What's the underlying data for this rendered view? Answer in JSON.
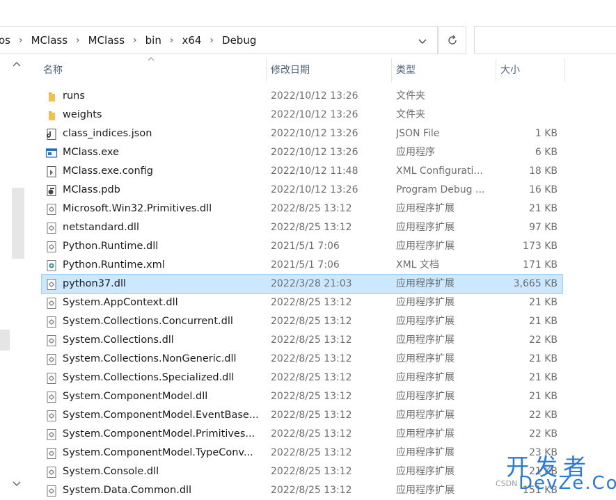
{
  "breadcrumb": {
    "items": [
      "os",
      "MClass",
      "MClass",
      "bin",
      "x64",
      "Debug"
    ]
  },
  "columns": {
    "name": "名称",
    "date": "修改日期",
    "type": "类型",
    "size": "大小"
  },
  "files": [
    {
      "name": "runs",
      "date": "2022/10/12 13:26",
      "type": "文件夹",
      "size": "",
      "icon": "folder-icon"
    },
    {
      "name": "weights",
      "date": "2022/10/12 13:26",
      "type": "文件夹",
      "size": "",
      "icon": "folder-icon"
    },
    {
      "name": "class_indices.json",
      "date": "2022/10/12 13:26",
      "type": "JSON File",
      "size": "1 KB",
      "icon": "json-file-icon"
    },
    {
      "name": "MClass.exe",
      "date": "2022/10/12 13:26",
      "type": "应用程序",
      "size": "6 KB",
      "icon": "exe-file-icon"
    },
    {
      "name": "MClass.exe.config",
      "date": "2022/10/12 11:48",
      "type": "XML Configurati...",
      "size": "18 KB",
      "icon": "config-file-icon"
    },
    {
      "name": "MClass.pdb",
      "date": "2022/10/12 13:26",
      "type": "Program Debug ...",
      "size": "16 KB",
      "icon": "pdb-file-icon"
    },
    {
      "name": "Microsoft.Win32.Primitives.dll",
      "date": "2022/8/25 13:12",
      "type": "应用程序扩展",
      "size": "21 KB",
      "icon": "dll-file-icon"
    },
    {
      "name": "netstandard.dll",
      "date": "2022/8/25 13:12",
      "type": "应用程序扩展",
      "size": "97 KB",
      "icon": "dll-file-icon"
    },
    {
      "name": "Python.Runtime.dll",
      "date": "2021/5/1 7:06",
      "type": "应用程序扩展",
      "size": "173 KB",
      "icon": "dll-file-icon"
    },
    {
      "name": "Python.Runtime.xml",
      "date": "2021/5/1 7:06",
      "type": "XML 文档",
      "size": "171 KB",
      "icon": "xml-file-icon"
    },
    {
      "name": "python37.dll",
      "date": "2022/3/28 21:03",
      "type": "应用程序扩展",
      "size": "3,665 KB",
      "icon": "dll-file-icon",
      "selected": true
    },
    {
      "name": "System.AppContext.dll",
      "date": "2022/8/25 13:12",
      "type": "应用程序扩展",
      "size": "21 KB",
      "icon": "dll-file-icon"
    },
    {
      "name": "System.Collections.Concurrent.dll",
      "date": "2022/8/25 13:12",
      "type": "应用程序扩展",
      "size": "21 KB",
      "icon": "dll-file-icon"
    },
    {
      "name": "System.Collections.dll",
      "date": "2022/8/25 13:12",
      "type": "应用程序扩展",
      "size": "22 KB",
      "icon": "dll-file-icon"
    },
    {
      "name": "System.Collections.NonGeneric.dll",
      "date": "2022/8/25 13:12",
      "type": "应用程序扩展",
      "size": "21 KB",
      "icon": "dll-file-icon"
    },
    {
      "name": "System.Collections.Specialized.dll",
      "date": "2022/8/25 13:12",
      "type": "应用程序扩展",
      "size": "21 KB",
      "icon": "dll-file-icon"
    },
    {
      "name": "System.ComponentModel.dll",
      "date": "2022/8/25 13:12",
      "type": "应用程序扩展",
      "size": "21 KB",
      "icon": "dll-file-icon"
    },
    {
      "name": "System.ComponentModel.EventBase...",
      "date": "2022/8/25 13:12",
      "type": "应用程序扩展",
      "size": "22 KB",
      "icon": "dll-file-icon"
    },
    {
      "name": "System.ComponentModel.Primitives...",
      "date": "2022/8/25 13:12",
      "type": "应用程序扩展",
      "size": "22 KB",
      "icon": "dll-file-icon"
    },
    {
      "name": "System.ComponentModel.TypeConv...",
      "date": "2022/8/25 13:12",
      "type": "应用程序扩展",
      "size": "23 KB",
      "icon": "dll-file-icon"
    },
    {
      "name": "System.Console.dll",
      "date": "2022/8/25 13:12",
      "type": "应用程序扩展",
      "size": "21 KB",
      "icon": "dll-file-icon"
    },
    {
      "name": "System.Data.Common.dll",
      "date": "2022/8/25 13:12",
      "type": "应用程序扩展",
      "size": "151 KB",
      "icon": "dll-file-icon"
    }
  ],
  "watermark": {
    "brand_cn": "开发者",
    "brand_en": "DevZe.CoM",
    "source": "CSDN"
  },
  "colors": {
    "selected_bg": "#cce8ff",
    "selected_border": "#99d1ff",
    "header_text": "#4c607a",
    "folder": "#f2c14e",
    "watermark": "#2a7bd1"
  }
}
